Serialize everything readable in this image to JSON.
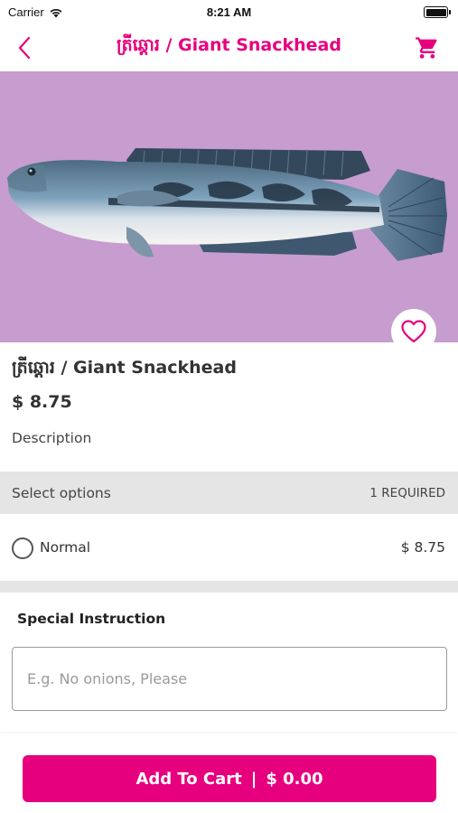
{
  "status_bar": {
    "carrier": "Carrier",
    "time": "8:21 AM",
    "icons": [
      "wifi-icon",
      "battery-icon"
    ]
  },
  "nav": {
    "title": "ត្រីឆ្ដោរ / Giant Snackhead",
    "back_icon": "chevron-left-icon",
    "cart_icon": "shopping-cart-icon"
  },
  "product": {
    "image_icon": "fish-photo",
    "favorite_icon": "heart-outline-icon",
    "name": "ត្រីឆ្ដោរ / Giant Snackhead",
    "price": "$ 8.75",
    "description_label": "Description"
  },
  "options": {
    "title": "Select options",
    "required": "1 REQUIRED",
    "items": [
      {
        "label": "Normal",
        "price": "$ 8.75",
        "selected": false
      }
    ]
  },
  "special": {
    "title": "Special Instruction",
    "placeholder": "E.g. No onions, Please",
    "value": ""
  },
  "cart_button": {
    "label": "Add To Cart",
    "separator": "|",
    "total": "$ 0.00"
  },
  "colors": {
    "accent": "#e6007e",
    "hero_background": "#c69dce",
    "section_band": "#e5e5e5"
  }
}
